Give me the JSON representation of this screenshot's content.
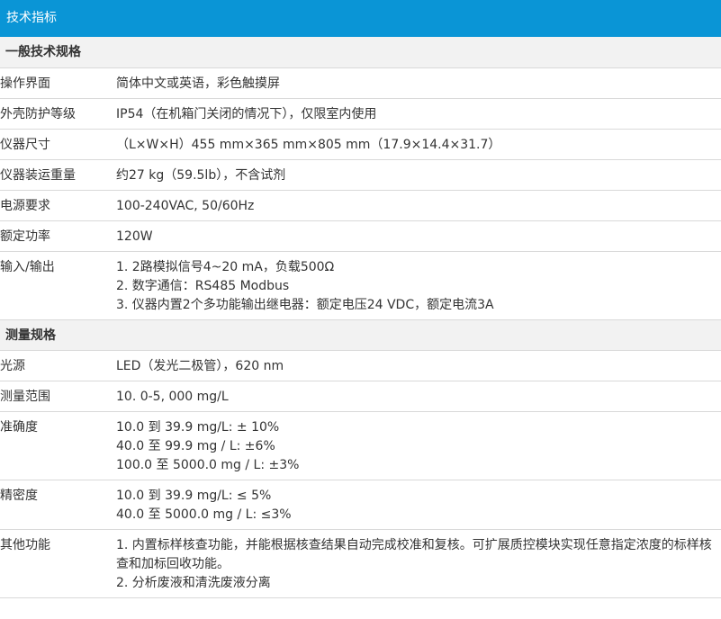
{
  "title": "技术指标",
  "rows": [
    {
      "type": "section",
      "label": "一般技术规格"
    },
    {
      "type": "row",
      "label": "操作界面",
      "values": [
        "简体中文或英语，彩色触摸屏"
      ]
    },
    {
      "type": "row",
      "label": "外壳防护等级",
      "values": [
        "IP54（在机箱门关闭的情况下），仅限室内使用"
      ]
    },
    {
      "type": "row",
      "label": "仪器尺寸",
      "values": [
        "（L×W×H）455 mm×365 mm×805 mm（17.9×14.4×31.7）"
      ]
    },
    {
      "type": "row",
      "label": "仪器装运重量",
      "values": [
        "约27 kg（59.5lb），不含试剂"
      ]
    },
    {
      "type": "row",
      "label": "电源要求",
      "values": [
        "100-240VAC, 50/60Hz"
      ]
    },
    {
      "type": "row",
      "label": "额定功率",
      "values": [
        "120W"
      ]
    },
    {
      "type": "row",
      "label": "输入/输出",
      "values": [
        "1. 2路模拟信号4~20 mA，负载500Ω",
        "2. 数字通信：RS485 Modbus",
        "3. 仪器内置2个多功能输出继电器：额定电压24 VDC，额定电流3A"
      ]
    },
    {
      "type": "section",
      "label": "测量规格"
    },
    {
      "type": "row",
      "label": "光源",
      "values": [
        "LED（发光二极管），620 nm"
      ]
    },
    {
      "type": "row",
      "label": "测量范围",
      "values": [
        "10. 0-5, 000 mg/L"
      ]
    },
    {
      "type": "row",
      "label": "准确度",
      "values": [
        "10.0 到 39.9 mg/L: ± 10%",
        "40.0 至 99.9 mg / L:  ±6%",
        "100.0 至 5000.0 mg / L:  ±3%"
      ]
    },
    {
      "type": "row",
      "label": "精密度",
      "values": [
        "10.0 到 39.9 mg/L: ≤ 5%",
        "40.0 至 5000.0 mg / L:  ≤3%"
      ]
    },
    {
      "type": "row",
      "label": "其他功能",
      "values": [
        "1. 内置标样核查功能，并能根据核查结果自动完成校准和复核。可扩展质控模块实现任意指定浓度的标样核查和加标回收功能。",
        "2. 分析废液和清洗废液分离"
      ]
    }
  ]
}
